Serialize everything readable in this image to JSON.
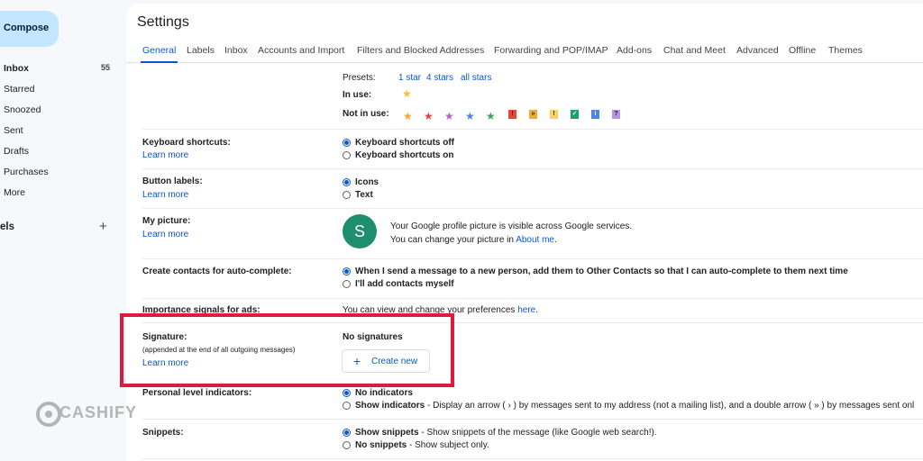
{
  "sidebar": {
    "compose_label": "Compose",
    "items": [
      {
        "label": "Inbox",
        "count": "55"
      },
      {
        "label": "Starred"
      },
      {
        "label": "Snoozed"
      },
      {
        "label": "Sent"
      },
      {
        "label": "Drafts"
      },
      {
        "label": "Purchases"
      },
      {
        "label": "More"
      }
    ],
    "labels_heading": "els"
  },
  "header": {
    "title": "Settings"
  },
  "tabs": [
    "General",
    "Labels",
    "Inbox",
    "Accounts and Import",
    "Filters and Blocked Addresses",
    "Forwarding and POP/IMAP",
    "Add-ons",
    "Chat and Meet",
    "Advanced",
    "Offline",
    "Themes"
  ],
  "stars": {
    "presets_label": "Presets:",
    "presets": [
      "1 star",
      "4 stars",
      "all stars"
    ],
    "in_use_label": "In use:",
    "not_in_use_label": "Not in use:"
  },
  "keyboard": {
    "label": "Keyboard shortcuts:",
    "learn_more": "Learn more",
    "options": [
      "Keyboard shortcuts off",
      "Keyboard shortcuts on"
    ]
  },
  "button_labels": {
    "label": "Button labels:",
    "learn_more": "Learn more",
    "options": [
      "Icons",
      "Text"
    ]
  },
  "my_picture": {
    "label": "My picture:",
    "learn_more": "Learn more",
    "avatar_letter": "S",
    "line1": "Your Google profile picture is visible across Google services.",
    "line2_prefix": "You can change your picture in",
    "line2_link": "About me",
    "line2_suffix": "."
  },
  "contacts": {
    "label": "Create contacts for auto-complete:",
    "options": [
      "When I send a message to a new person, add them to Other Contacts so that I can auto-complete to them next time",
      "I'll add contacts myself"
    ]
  },
  "importance": {
    "label": "Importance signals for ads:",
    "text_prefix": "You can view and change your preferences",
    "link": "here",
    "text_suffix": "."
  },
  "signature": {
    "label": "Signature:",
    "sublabel": "(appended at the end of all outgoing messages)",
    "learn_more": "Learn more",
    "status": "No signatures",
    "create_new": "Create new"
  },
  "personal_level": {
    "label": "Personal level indicators:",
    "option1": "No indicators",
    "option2_bold": "Show indicators",
    "option2_rest": " - Display an arrow ( › ) by messages sent to my address (not a mailing list), and a double arrow ( » ) by messages sent onl"
  },
  "snippets": {
    "label": "Snippets:",
    "option1_bold": "Show snippets",
    "option1_rest": " - Show snippets of the message (like Google web search!).",
    "option2_bold": "No snippets",
    "option2_rest": " - Show subject only."
  },
  "watermark": {
    "text": "CASHIFY"
  },
  "colors": {
    "accent": "#0b57d0",
    "highlight": "#e0193f",
    "avatar": "#1e8e6e",
    "compose": "#c2e7ff"
  }
}
